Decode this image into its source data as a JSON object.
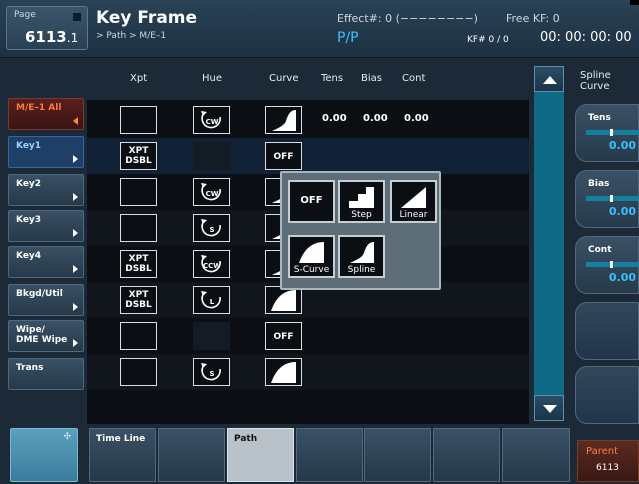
{
  "header": {
    "page_label": "Page",
    "page_number": "6113",
    "page_sub": ".1",
    "title": "Key Frame",
    "breadcrumb": "> Path > M/E–1",
    "effect": "Effect#: 0 (−−−−−−−−)",
    "pp": "P/P",
    "free_kf": "Free KF: 0",
    "kf_number": "KF# 0 / 0",
    "timecode": "00: 00: 00: 00"
  },
  "left_menu": [
    {
      "label": "M/E–1 All",
      "state": "selected"
    },
    {
      "label": "Key1",
      "state": "active"
    },
    {
      "label": "Key2",
      "state": "normal"
    },
    {
      "label": "Key3",
      "state": "normal"
    },
    {
      "label": "Key4",
      "state": "normal"
    },
    {
      "label": "Bkgd/Util",
      "state": "normal"
    },
    {
      "label": "Wipe/\nDME Wipe",
      "state": "normal"
    },
    {
      "label": "Trans",
      "state": "normal"
    }
  ],
  "table": {
    "headers": [
      "Xpt",
      "Hue",
      "Curve",
      "Tens",
      "Bias",
      "Cont"
    ],
    "rows": [
      {
        "xpt": "",
        "hue": "CW",
        "curve": "spline",
        "tens": "0.00",
        "bias": "0.00",
        "cont": "0.00"
      },
      {
        "xpt": "XPT DSBL",
        "hue": "",
        "curve": "OFF"
      },
      {
        "xpt": "",
        "hue": "CW",
        "curve": "spline"
      },
      {
        "xpt": "",
        "hue": "S",
        "curve": "spline"
      },
      {
        "xpt": "XPT DSBL",
        "hue": "CCW",
        "curve": "spline"
      },
      {
        "xpt": "XPT DSBL",
        "hue": "L",
        "curve": "scurve"
      },
      {
        "xpt": "",
        "hue": "",
        "curve": "OFF"
      },
      {
        "xpt": "",
        "hue": "S",
        "curve": "scurve"
      }
    ],
    "xpt_dsbl_line1": "XPT",
    "xpt_dsbl_line2": "DSBL",
    "off_label": "OFF"
  },
  "popup": {
    "items": [
      "OFF",
      "Step",
      "Linear",
      "S-Curve",
      "Spline"
    ]
  },
  "right_panel": {
    "label_line1": "Spline",
    "label_line2": "Curve",
    "knobs": [
      {
        "label": "Tens",
        "value": "0.00",
        "level": 0.5
      },
      {
        "label": "Bias",
        "value": "0.00",
        "level": 0.5
      },
      {
        "label": "Cont",
        "value": "0.00",
        "level": 0.5
      }
    ]
  },
  "bottom": {
    "tabs": [
      "Time Line",
      "",
      "Path",
      "",
      "",
      "",
      ""
    ],
    "active_tab": "Path",
    "parent_label": "Parent",
    "parent_page": "6113"
  },
  "colors": {
    "accent_blue": "#39c1ff",
    "accent_orange": "#ff7a3a",
    "teal": "#0f6a86"
  }
}
